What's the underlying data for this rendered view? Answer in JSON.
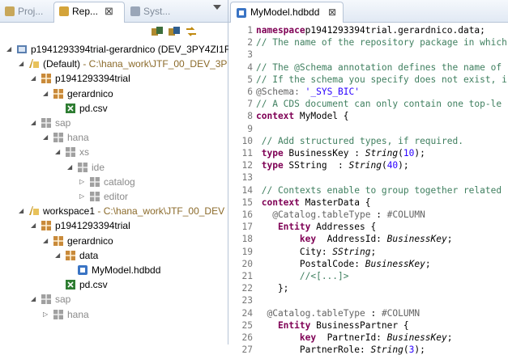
{
  "left_tabs": [
    {
      "label": "Proj...",
      "active": false
    },
    {
      "label": "Rep...",
      "active": true
    },
    {
      "label": "Syst...",
      "active": false
    }
  ],
  "close_glyph": "⊠",
  "tree": [
    {
      "label": "p1941293394trial-gerardnico (DEV_3PY4ZI1F",
      "suffix": "",
      "icon": "system-icon",
      "indent": 0,
      "arrow": "expanded"
    },
    {
      "label": "(Default)",
      "suffix": " - C:\\hana_work\\JTF_00_DEV_3P",
      "icon": "workspace-icon",
      "indent": 1,
      "arrow": "expanded"
    },
    {
      "label": "p1941293394trial",
      "suffix": "",
      "icon": "package-icon",
      "indent": 2,
      "arrow": "expanded"
    },
    {
      "label": "gerardnico",
      "suffix": "",
      "icon": "package-icon",
      "indent": 3,
      "arrow": "expanded"
    },
    {
      "label": "pd.csv",
      "suffix": "",
      "icon": "csv-file-icon",
      "indent": 4,
      "arrow": "none"
    },
    {
      "label": "sap",
      "suffix": "",
      "icon": "package-gray-icon",
      "indent": 2,
      "arrow": "expanded",
      "gray": true
    },
    {
      "label": "hana",
      "suffix": "",
      "icon": "package-gray-icon",
      "indent": 3,
      "arrow": "expanded",
      "gray": true
    },
    {
      "label": "xs",
      "suffix": "",
      "icon": "package-gray-icon",
      "indent": 4,
      "arrow": "expanded",
      "gray": true
    },
    {
      "label": "ide",
      "suffix": "",
      "icon": "package-gray-icon",
      "indent": 5,
      "arrow": "expanded",
      "gray": true
    },
    {
      "label": "catalog",
      "suffix": "",
      "icon": "package-gray-icon",
      "indent": 6,
      "arrow": "collapsed",
      "gray": true
    },
    {
      "label": "editor",
      "suffix": "",
      "icon": "package-gray-icon",
      "indent": 6,
      "arrow": "collapsed",
      "gray": true
    },
    {
      "label": "workspace1",
      "suffix": " - C:\\hana_work\\JTF_00_DEV",
      "icon": "workspace-icon",
      "indent": 1,
      "arrow": "expanded"
    },
    {
      "label": "p1941293394trial",
      "suffix": "",
      "icon": "package-icon",
      "indent": 2,
      "arrow": "expanded"
    },
    {
      "label": "gerardnico",
      "suffix": "",
      "icon": "package-icon",
      "indent": 3,
      "arrow": "expanded"
    },
    {
      "label": "data",
      "suffix": "",
      "icon": "package-icon",
      "indent": 4,
      "arrow": "expanded"
    },
    {
      "label": "MyModel.hdbdd",
      "suffix": "",
      "icon": "hdbdd-file-icon",
      "indent": 5,
      "arrow": "none"
    },
    {
      "label": "pd.csv",
      "suffix": "",
      "icon": "csv-file-icon",
      "indent": 4,
      "arrow": "none"
    },
    {
      "label": "sap",
      "suffix": "",
      "icon": "package-gray-icon",
      "indent": 2,
      "arrow": "expanded",
      "gray": true
    },
    {
      "label": "hana",
      "suffix": "",
      "icon": "package-gray-icon",
      "indent": 3,
      "arrow": "collapsed",
      "gray": true
    }
  ],
  "editor": {
    "tab_label": "MyModel.hdbdd",
    "lines": [
      {
        "n": "1",
        "parts": [
          [
            "kw",
            "namespace"
          ],
          [
            "",
            "p1941293394trial.gerardnico.data;"
          ]
        ]
      },
      {
        "n": "2",
        "parts": [
          [
            "cm",
            "// The name of the repository package in which"
          ]
        ]
      },
      {
        "n": "3",
        "parts": []
      },
      {
        "n": "4",
        "parts": [
          [
            "cm",
            "// The @Schema annotation defines the name of"
          ]
        ]
      },
      {
        "n": "5",
        "parts": [
          [
            "cm",
            "// If the schema you specify does not exist, i"
          ]
        ]
      },
      {
        "n": "6",
        "parts": [
          [
            "an",
            "@Schema: "
          ],
          [
            "st",
            "'_SYS_BIC'"
          ]
        ]
      },
      {
        "n": "7",
        "parts": [
          [
            "cm",
            "// A CDS document can only contain one top-le"
          ]
        ]
      },
      {
        "n": "8",
        "parts": [
          [
            "kw",
            "context"
          ],
          [
            "",
            " MyModel {"
          ]
        ]
      },
      {
        "n": "9",
        "parts": []
      },
      {
        "n": "10",
        "parts": [
          [
            "cm",
            " // Add structured types, if required."
          ]
        ]
      },
      {
        "n": "11",
        "parts": [
          [
            "kw",
            " type"
          ],
          [
            "",
            " BusinessKey : "
          ],
          [
            "ty",
            "String"
          ],
          [
            "",
            "("
          ],
          [
            "num",
            "10"
          ],
          [
            "",
            ");"
          ]
        ]
      },
      {
        "n": "12",
        "parts": [
          [
            "kw",
            " type"
          ],
          [
            "",
            " SString  : "
          ],
          [
            "ty",
            "String"
          ],
          [
            "",
            "("
          ],
          [
            "num",
            "40"
          ],
          [
            "",
            ");"
          ]
        ]
      },
      {
        "n": "13",
        "parts": []
      },
      {
        "n": "14",
        "parts": [
          [
            "cm",
            " // Contexts enable to group together related"
          ]
        ]
      },
      {
        "n": "15",
        "parts": [
          [
            "kw",
            " context"
          ],
          [
            "",
            " MasterData {"
          ]
        ]
      },
      {
        "n": "16",
        "parts": [
          [
            "an",
            "   @Catalog.tableType"
          ],
          [
            "",
            " : "
          ],
          [
            "an",
            "#COLUMN"
          ]
        ]
      },
      {
        "n": "17",
        "parts": [
          [
            "kw",
            "    Entity"
          ],
          [
            "",
            " Addresses {"
          ]
        ]
      },
      {
        "n": "18",
        "parts": [
          [
            "kw",
            "        key"
          ],
          [
            "",
            "  AddressId: "
          ],
          [
            "ty",
            "BusinessKey"
          ],
          [
            "",
            ";"
          ]
        ]
      },
      {
        "n": "19",
        "parts": [
          [
            "",
            "        City: "
          ],
          [
            "ty",
            "SString"
          ],
          [
            "",
            ";"
          ]
        ]
      },
      {
        "n": "20",
        "parts": [
          [
            "",
            "        PostalCode: "
          ],
          [
            "ty",
            "BusinessKey"
          ],
          [
            "",
            ";"
          ]
        ]
      },
      {
        "n": "21",
        "parts": [
          [
            "cm",
            "        //<[...]>"
          ]
        ]
      },
      {
        "n": "22",
        "parts": [
          [
            "",
            "    };"
          ]
        ]
      },
      {
        "n": "23",
        "parts": []
      },
      {
        "n": "24",
        "parts": [
          [
            "an",
            "  @Catalog.tableType"
          ],
          [
            "",
            " : "
          ],
          [
            "an",
            "#COLUMN"
          ]
        ]
      },
      {
        "n": "25",
        "parts": [
          [
            "kw",
            "    Entity"
          ],
          [
            "",
            " BusinessPartner {"
          ]
        ]
      },
      {
        "n": "26",
        "parts": [
          [
            "kw",
            "        key"
          ],
          [
            "",
            "  PartnerId: "
          ],
          [
            "ty",
            "BusinessKey"
          ],
          [
            "",
            ";"
          ]
        ]
      },
      {
        "n": "27",
        "parts": [
          [
            "",
            "        PartnerRole: "
          ],
          [
            "ty",
            "String"
          ],
          [
            "",
            "("
          ],
          [
            "num",
            "3"
          ],
          [
            "",
            ");"
          ]
        ]
      }
    ]
  }
}
